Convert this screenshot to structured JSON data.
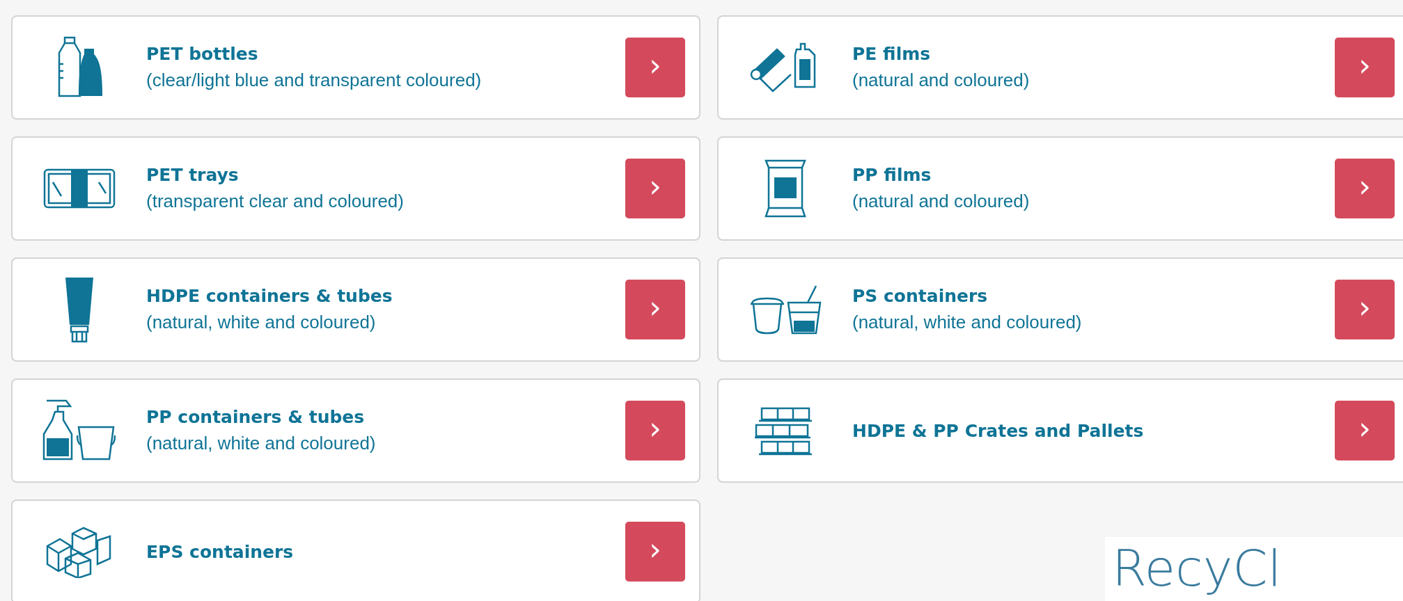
{
  "categories": [
    {
      "kind": "bottles",
      "title": "PET bottles",
      "subtitle": "(clear/light blue and transparent coloured)",
      "button": "›"
    },
    {
      "kind": "film-roll",
      "title": "PE films",
      "subtitle": "(natural and coloured)",
      "button": "›"
    },
    {
      "kind": "tray",
      "title": "PET trays",
      "subtitle": "(transparent clear and coloured)",
      "button": "›"
    },
    {
      "kind": "bag",
      "title": "PP films",
      "subtitle": "(natural and coloured)",
      "button": "›"
    },
    {
      "kind": "tube",
      "title": "HDPE containers & tubes",
      "subtitle": "(natural, white and coloured)",
      "button": "›"
    },
    {
      "kind": "cups",
      "title": "PS containers",
      "subtitle": "(natural, white and coloured)",
      "button": "›"
    },
    {
      "kind": "spray-bucket",
      "title": "PP containers & tubes",
      "subtitle": "(natural, white and coloured)",
      "button": "›"
    },
    {
      "kind": "crates",
      "title": "HDPE & PP Crates and Pallets",
      "button": "›"
    },
    {
      "kind": "blocks",
      "title": "EPS containers",
      "button": "›"
    }
  ],
  "logo": {
    "text": "RecyCl"
  }
}
